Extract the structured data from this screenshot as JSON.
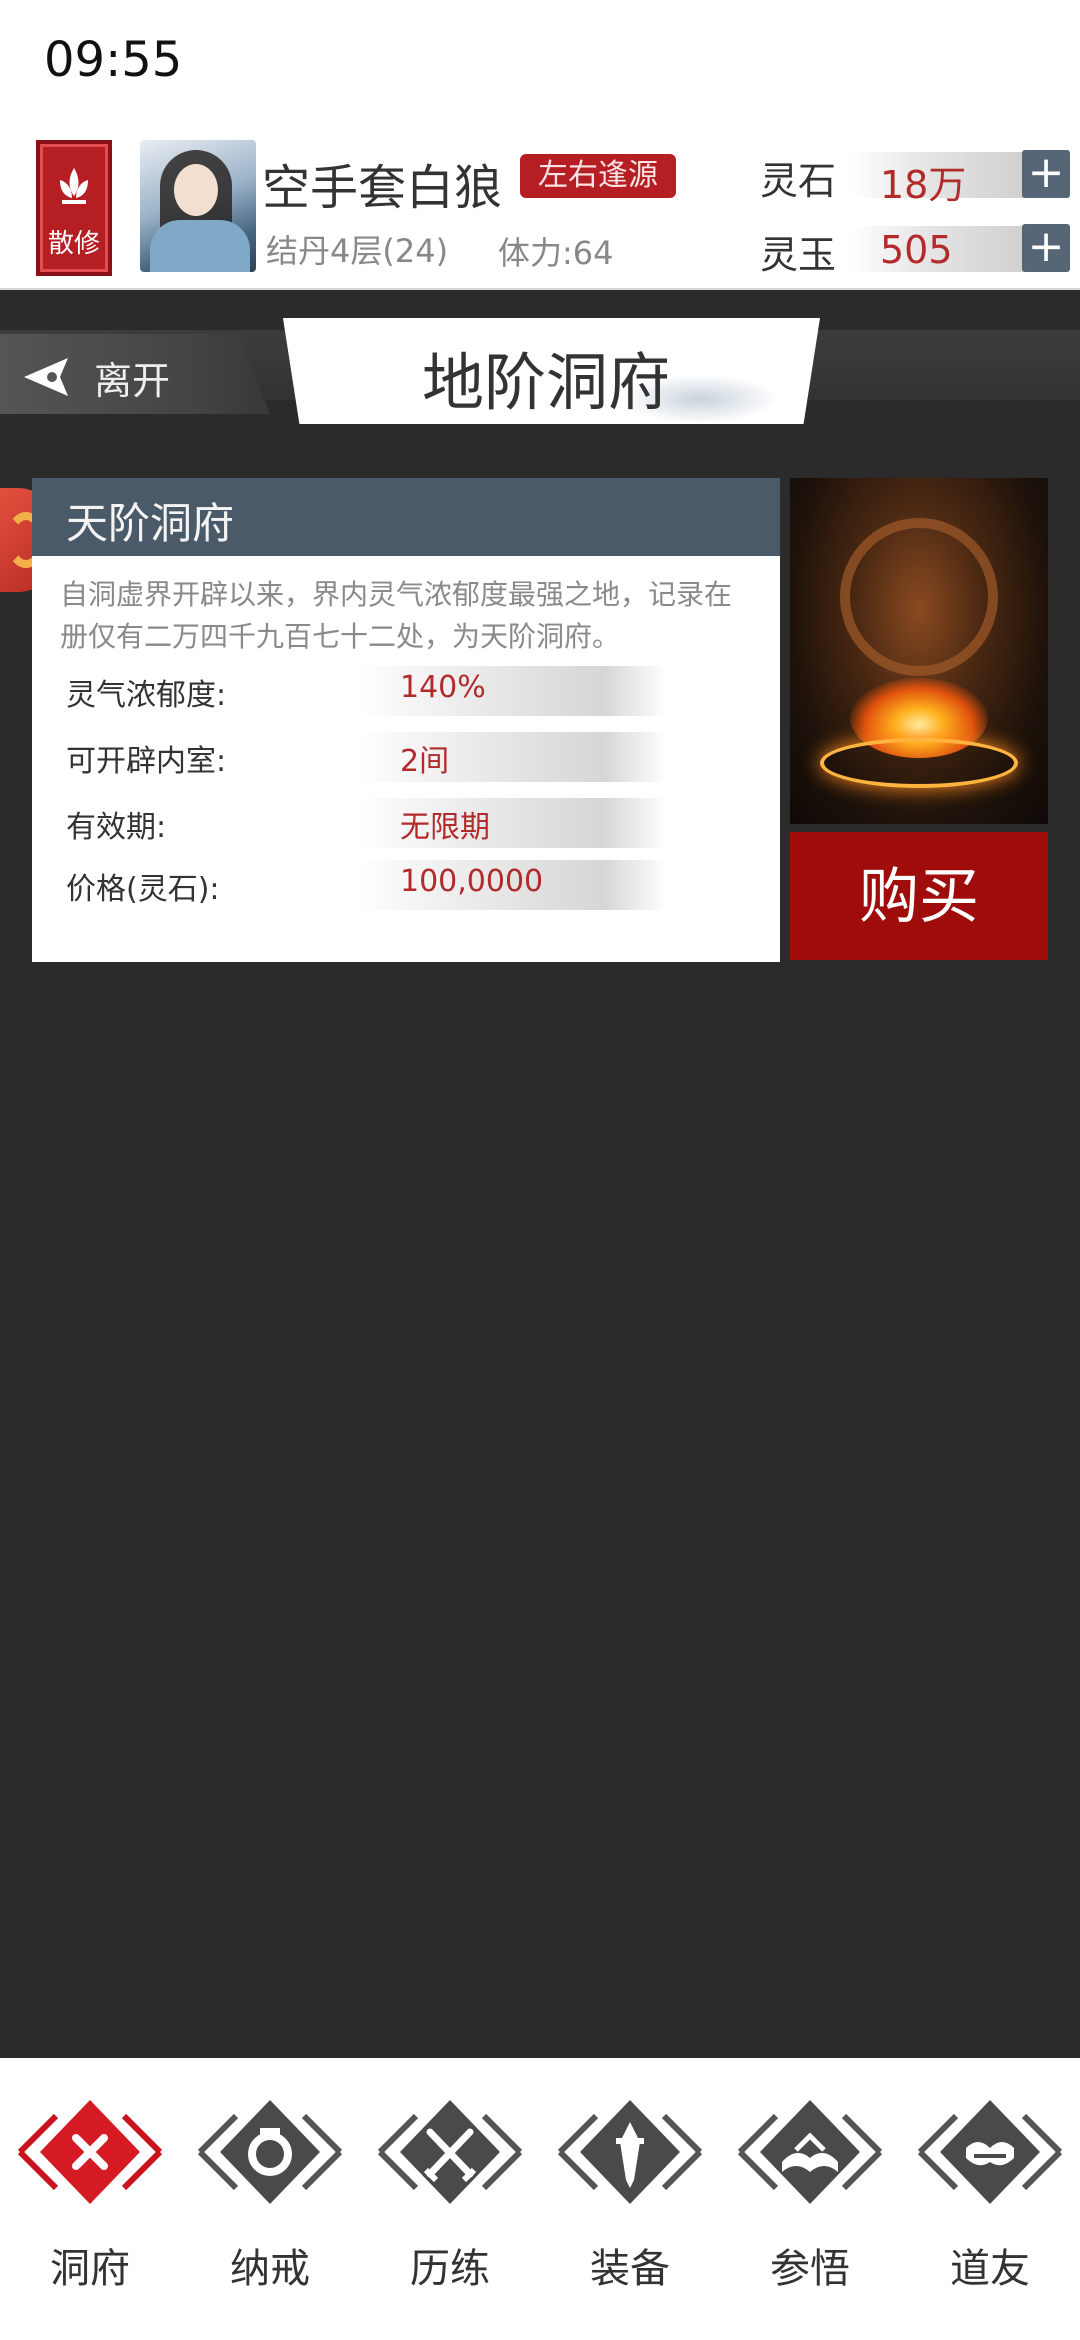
{
  "status_bar": {
    "time": "09:55"
  },
  "player": {
    "sect_label": "散修",
    "name": "空手套白狼",
    "tag": "左右逢源",
    "realm": "结丹4层(24)",
    "stamina": "体力:64"
  },
  "currencies": [
    {
      "label": "灵石",
      "value": "18万",
      "add_icon": "plus-icon"
    },
    {
      "label": "灵玉",
      "value": "505",
      "add_icon": "plus-icon"
    }
  ],
  "title_bar": {
    "leave_label": "离开",
    "title": "地阶洞府"
  },
  "card": {
    "title": "天阶洞府",
    "description": "自洞虚界开辟以来，界内灵气浓郁度最强之地，记录在册仅有二万四千九百七十二处，为天阶洞府。",
    "rows": [
      {
        "label": "灵气浓郁度:",
        "value": "140%"
      },
      {
        "label": "可开辟内室:",
        "value": "2间"
      },
      {
        "label": "有效期:",
        "value": "无限期"
      },
      {
        "label": "价格(灵石):",
        "value": "100,0000"
      }
    ]
  },
  "buy_label": "购买",
  "bottom_nav": [
    {
      "label": "洞府",
      "icon": "cross-icon",
      "active": true
    },
    {
      "label": "纳戒",
      "icon": "ring-icon",
      "active": false
    },
    {
      "label": "历练",
      "icon": "crossed-swords-icon",
      "active": false
    },
    {
      "label": "装备",
      "icon": "sword-icon",
      "active": false
    },
    {
      "label": "参悟",
      "icon": "book-icon",
      "active": false
    },
    {
      "label": "道友",
      "icon": "handshake-icon",
      "active": false
    }
  ],
  "colors": {
    "accent": "#a00c0c",
    "card_header": "#4a5a68",
    "value_text": "#b22a2a",
    "background": "#2b2b2b"
  }
}
